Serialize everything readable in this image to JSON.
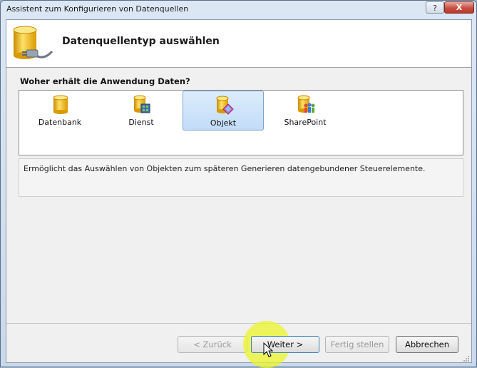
{
  "window": {
    "title": "Assistent zum Konfigurieren von Datenquellen",
    "help_label": "?",
    "close_label": "X"
  },
  "header": {
    "title": "Datenquellentyp auswählen",
    "icon": "database-plug-icon"
  },
  "question": "Woher erhält die Anwendung Daten?",
  "source_types": [
    {
      "label": "Datenbank",
      "icon": "database-icon",
      "selected": false
    },
    {
      "label": "Dienst",
      "icon": "database-service-icon",
      "selected": false
    },
    {
      "label": "Objekt",
      "icon": "database-object-icon",
      "selected": true
    },
    {
      "label": "SharePoint",
      "icon": "database-sharepoint-icon",
      "selected": false
    }
  ],
  "description": "Ermöglicht das Auswählen von Objekten zum späteren Generieren datengebundener Steuerelemente.",
  "buttons": {
    "back": "< Zurück",
    "next": "Weiter >",
    "finish": "Fertig stellen",
    "cancel": "Abbrechen"
  },
  "colors": {
    "selection": "#c2dcf8",
    "cylinder": "#f2b90f",
    "click_highlight": "#ebf528"
  }
}
